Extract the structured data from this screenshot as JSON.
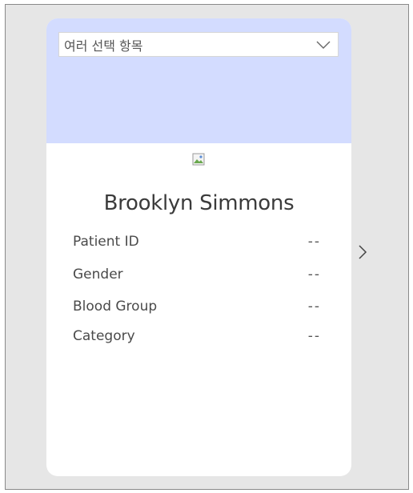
{
  "select": {
    "label": "여러 선택 항목",
    "icon": "chevron-down-icon"
  },
  "avatar": {
    "icon": "broken-image-icon"
  },
  "patient": {
    "name": "Brooklyn Simmons",
    "fields": [
      {
        "label": "Patient ID",
        "value": "--"
      },
      {
        "label": "Gender",
        "value": "--"
      },
      {
        "label": "Blood Group",
        "value": "--"
      },
      {
        "label": "Category",
        "value": "--"
      }
    ]
  },
  "navigation": {
    "next_icon": "chevron-right-icon"
  },
  "colors": {
    "header_background": "#d3dcff",
    "frame_background": "#e6e6e6",
    "card_background": "#ffffff"
  }
}
